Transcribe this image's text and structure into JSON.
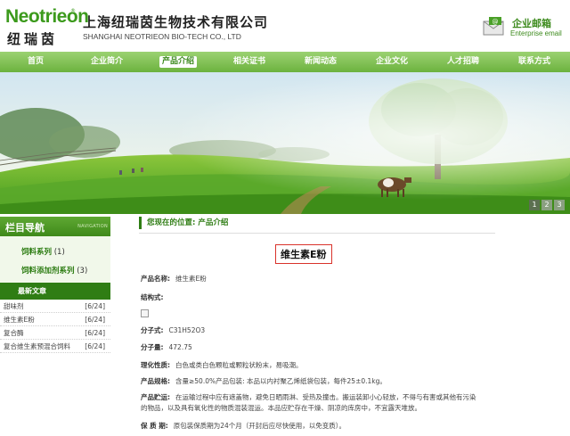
{
  "header": {
    "logo_word": "Neotrieon",
    "logo_reg": "®",
    "logo_cn": "纽瑞茵",
    "company_cn": "上海纽瑞茵生物技术有限公司",
    "company_en": "SHANGHAI NEOTRIEON BIO-TECH CO., LTD",
    "email_cn": "企业邮箱",
    "email_en": "Enterprise email"
  },
  "nav": {
    "items": [
      "首页",
      "企业简介",
      "产品介绍",
      "相关证书",
      "新闻动态",
      "企业文化",
      "人才招聘",
      "联系方式"
    ],
    "active_index": 2
  },
  "banner": {
    "pages": [
      "1",
      "2",
      "3"
    ]
  },
  "sidebar": {
    "title": "栏目导航",
    "title_en": "NAVIGATION",
    "categories": [
      {
        "name": "饲料系列",
        "count": "(1)"
      },
      {
        "name": "饲料添加剂系列",
        "count": "(3)"
      }
    ],
    "news_title": "最新文章",
    "news": [
      {
        "title": "甜味剂",
        "date": "[6/24]"
      },
      {
        "title": "维生素E粉",
        "date": "[6/24]"
      },
      {
        "title": "复合酶",
        "date": "[6/24]"
      },
      {
        "title": "复合维生素预混合饲料",
        "date": "[6/24]"
      }
    ]
  },
  "main": {
    "breadcrumb": "您现在的位置: 产品介绍",
    "product_title": "维生素E粉",
    "props": [
      {
        "k": "产品名称:",
        "v": "维生素E粉"
      },
      {
        "k": "结构式:",
        "v": ""
      },
      {
        "k": "分子式:",
        "v": "C31H52O3"
      },
      {
        "k": "分子量:",
        "v": "472.75"
      },
      {
        "k": "理化性质:",
        "v": "白色或类白色颗粒或颗粒状粉末，易吸潮。"
      },
      {
        "k": "产品规格:",
        "v": "含量≥50.0%产品包装: 本品以内衬聚乙烯纸袋包装，每件25±0.1kg。"
      },
      {
        "k": "产品贮运:",
        "v": "在运输过程中应有遮盖物，避免日晒雨淋、受热及撞击。搬运装卸小心轻放，不得与有害或其他有污染的物品，以及具有氧化性的物质混装混运。本品应贮存在干燥、阴凉的库房中，不宜露天堆放。"
      },
      {
        "k": "保 质 期:",
        "v": "原包装保质期为24个月（开封后应尽快使用，以免变质）。"
      }
    ]
  },
  "colors": {
    "brand_green": "#3c9a1c",
    "dark_green": "#2f7d14",
    "highlight_red": "#d9332b"
  }
}
